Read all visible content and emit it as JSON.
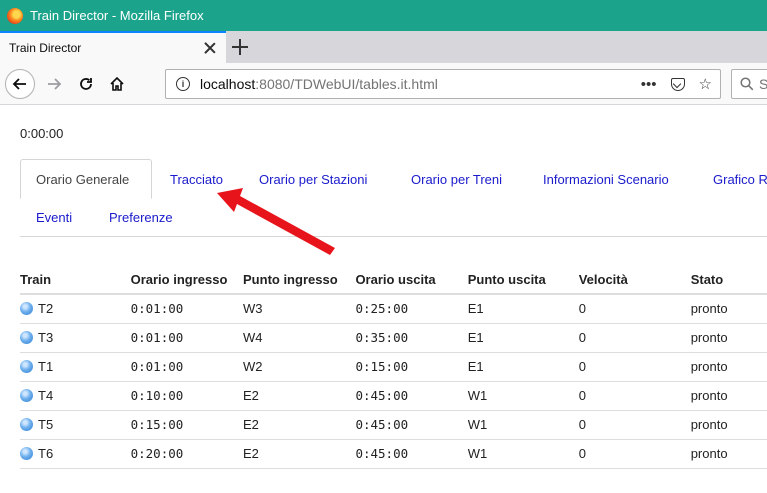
{
  "window": {
    "title": "Train Director - Mozilla Firefox"
  },
  "browser": {
    "tab_title": "Train Director",
    "url_host": "localhost",
    "url_rest": ":8080/TDWebUI/tables.it.html",
    "search_placeholder": "S"
  },
  "page": {
    "clock": "0:00:00",
    "tabs_row1": [
      "Orario Generale",
      "Tracciato",
      "Orario per Stazioni",
      "Orario per Treni",
      "Informazioni Scenario",
      "Grafico R"
    ],
    "tabs_row2": [
      "Eventi",
      "Preferenze"
    ],
    "active_tab": "Orario Generale"
  },
  "table": {
    "headers": [
      "Train",
      "Orario ingresso",
      "Punto ingresso",
      "Orario uscita",
      "Punto uscita",
      "Velocità",
      "Stato"
    ],
    "rows": [
      [
        "T2",
        "0:01:00",
        "W3",
        "0:25:00",
        "E1",
        "0",
        "pronto"
      ],
      [
        "T3",
        "0:01:00",
        "W4",
        "0:35:00",
        "E1",
        "0",
        "pronto"
      ],
      [
        "T1",
        "0:01:00",
        "W2",
        "0:15:00",
        "E1",
        "0",
        "pronto"
      ],
      [
        "T4",
        "0:10:00",
        "E2",
        "0:45:00",
        "W1",
        "0",
        "pronto"
      ],
      [
        "T5",
        "0:15:00",
        "E2",
        "0:45:00",
        "W1",
        "0",
        "pronto"
      ],
      [
        "T6",
        "0:20:00",
        "E2",
        "0:45:00",
        "W1",
        "0",
        "pronto"
      ]
    ]
  },
  "colors": {
    "titlebar": "#1ba38b",
    "link": "#1a1acc",
    "arrow": "#e8141b"
  }
}
